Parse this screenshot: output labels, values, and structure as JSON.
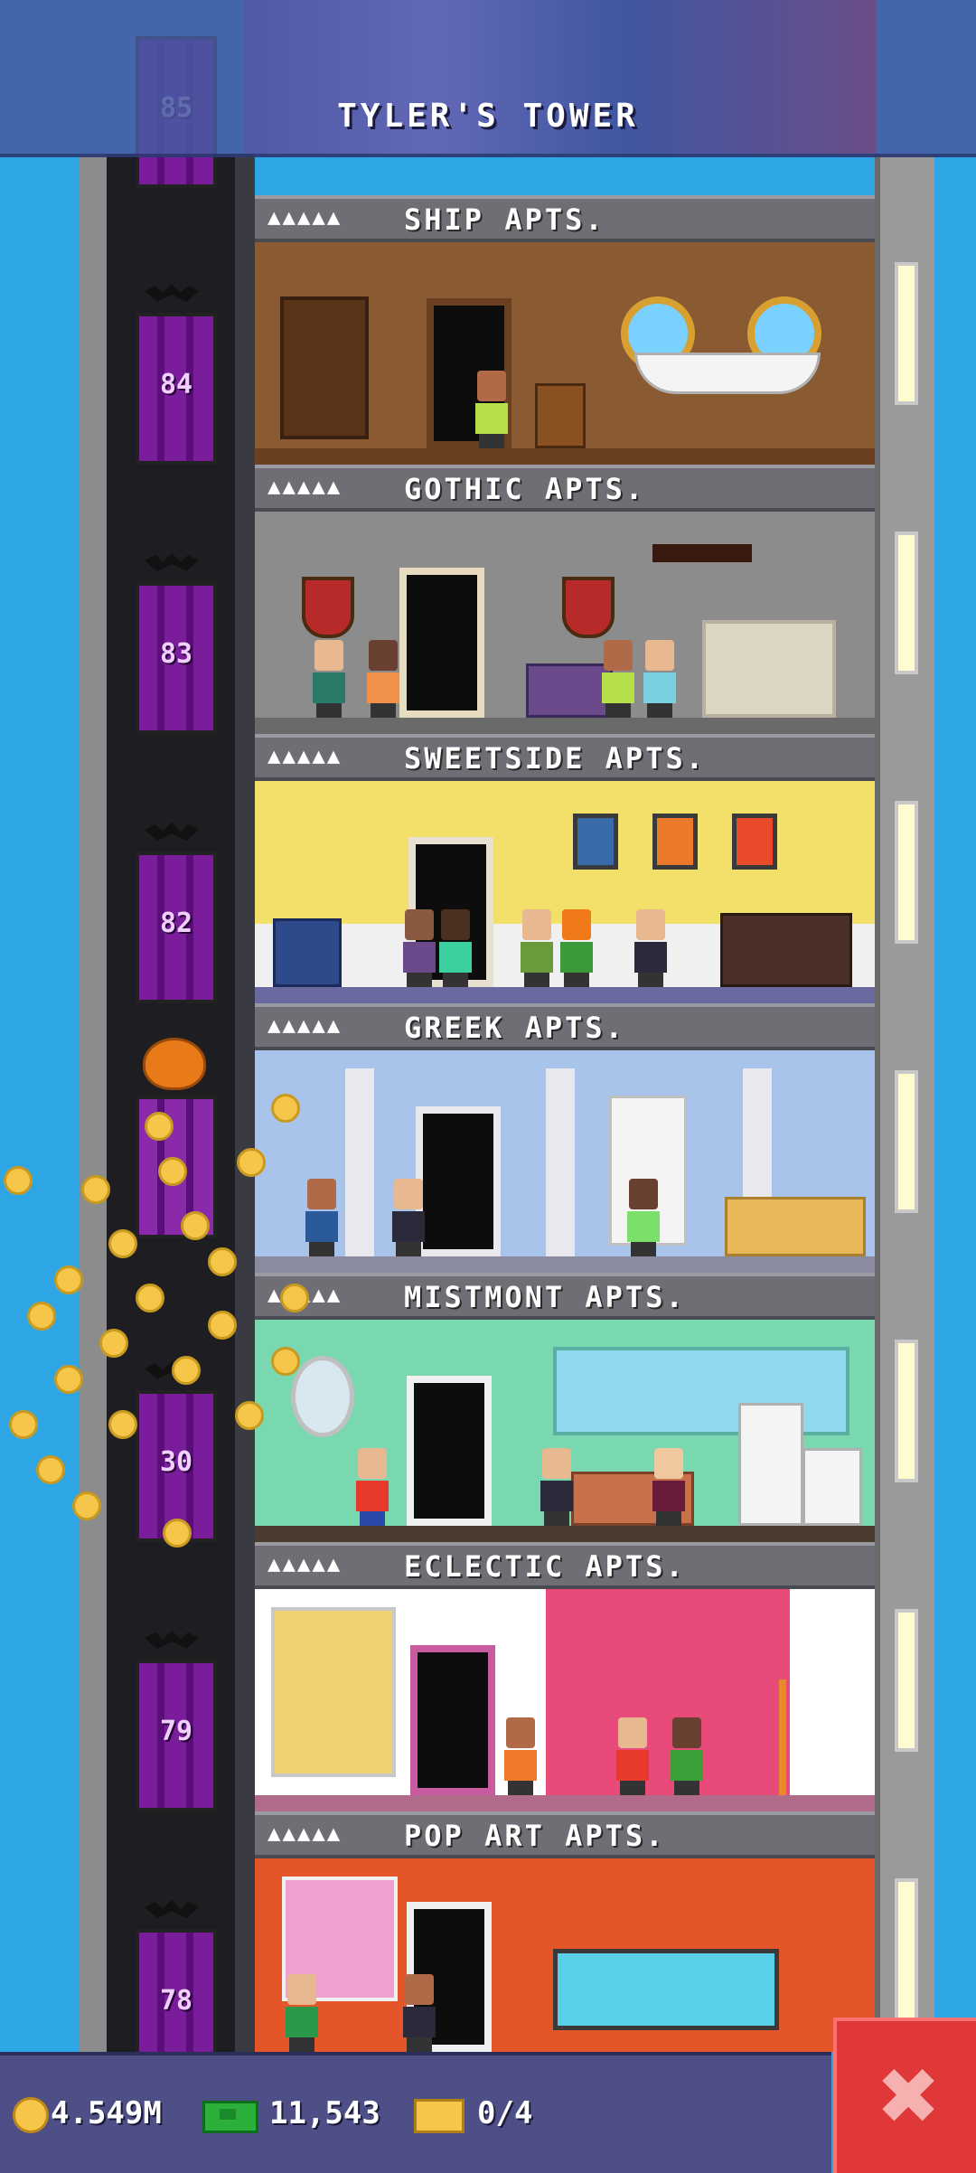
{
  "header": {
    "title": "TYLER'S TOWER"
  },
  "elevator": {
    "floor_numbers": [
      "85",
      "84",
      "83",
      "82",
      "30",
      "79",
      "78"
    ]
  },
  "floors": [
    {
      "stars": "▲▲▲▲▲",
      "name": "SHIP APTS.",
      "color": "#8a5a32"
    },
    {
      "stars": "▲▲▲▲▲",
      "name": "GOTHIC APTS.",
      "color": "#8c8c8c"
    },
    {
      "stars": "▲▲▲▲▲",
      "name": "SWEETSIDE APTS.",
      "color": "#f2e06a"
    },
    {
      "stars": "▲▲▲▲▲",
      "name": "GREEK APTS.",
      "color": "#a8c4ea"
    },
    {
      "stars": "▲▲▲▲▲",
      "name": "MISTMONT APTS.",
      "color": "#7ad8b0"
    },
    {
      "stars": "▲▲▲▲▲",
      "name": "ECLECTIC APTS.",
      "color": "#e84a7a"
    },
    {
      "stars": "▲▲▲▲▲",
      "name": "POP ART APTS.",
      "color": "#e4552a"
    }
  ],
  "status_bar": {
    "coins": "4.549M",
    "bux": "11,543",
    "tickets": "0/4"
  },
  "icons": {
    "coin": "coin-icon",
    "bux": "bux-icon",
    "ticket": "ticket-icon",
    "close": "close-icon"
  },
  "close_button": {
    "label": "✖"
  }
}
